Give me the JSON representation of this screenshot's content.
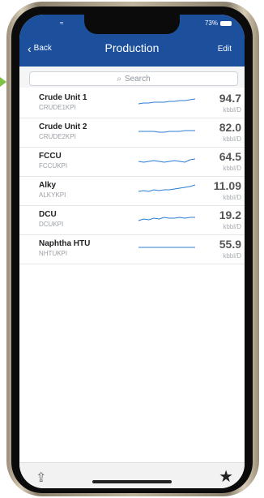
{
  "status": {
    "time": "",
    "right_text": "73%"
  },
  "nav": {
    "back_label": "Back",
    "title": "Production",
    "edit_label": "Edit"
  },
  "search": {
    "placeholder": "Search"
  },
  "rows": [
    {
      "name": "Crude Unit 1",
      "code": "CRUDE1KPI",
      "value": "94.7",
      "unit": "kbbl/D",
      "spark": [
        12,
        11,
        11,
        10,
        10,
        10,
        9,
        9,
        8,
        8,
        7,
        6
      ]
    },
    {
      "name": "Crude Unit 2",
      "code": "CRUDE2KPI",
      "value": "82.0",
      "unit": "kbbl/D",
      "spark": [
        10,
        10,
        10,
        10,
        11,
        11,
        10,
        10,
        10,
        9,
        9,
        9
      ]
    },
    {
      "name": "FCCU",
      "code": "FCCUKPI",
      "value": "64.5",
      "unit": "kbbl/D",
      "spark": [
        11,
        12,
        11,
        10,
        11,
        12,
        11,
        10,
        11,
        12,
        9,
        8
      ]
    },
    {
      "name": "Alky",
      "code": "ALKYKPI",
      "value": "11.09",
      "unit": "kbbl/D",
      "spark": [
        12,
        11,
        12,
        10,
        11,
        10,
        10,
        9,
        8,
        7,
        6,
        4
      ]
    },
    {
      "name": "DCU",
      "code": "DCUKPI",
      "value": "19.2",
      "unit": "kbbl/D",
      "spark": [
        12,
        10,
        11,
        9,
        10,
        8,
        9,
        9,
        8,
        9,
        8,
        8
      ]
    },
    {
      "name": "Naphtha HTU",
      "code": "NHTUKPI",
      "value": "55.9",
      "unit": "kbbl/D",
      "spark": [
        9,
        9,
        9,
        9,
        9,
        9,
        9,
        9,
        9,
        9,
        9,
        9
      ]
    }
  ],
  "colors": {
    "navbar": "#1c4f9c",
    "sparkline": "#2a7bd6"
  }
}
